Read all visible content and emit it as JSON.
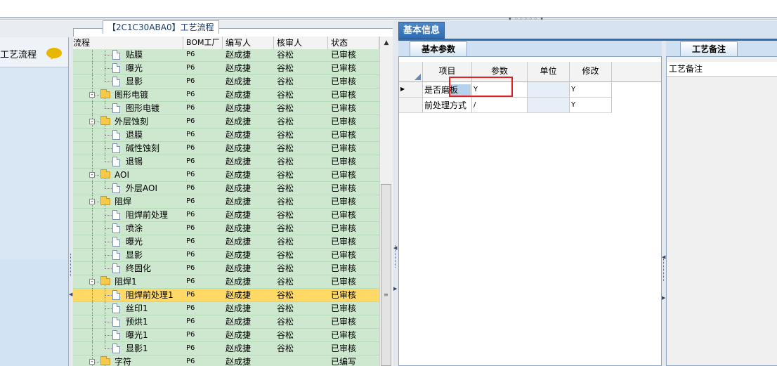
{
  "process_panel": {
    "title": "【2C1C30ABA0】工艺流程",
    "columns": [
      "流程",
      "BOM工厂",
      "编写人",
      "核审人",
      "状态"
    ],
    "rows": [
      {
        "name": "贴膜",
        "bom": "P6",
        "editor": "赵成捷",
        "reviewer": "谷松",
        "status": "已审核",
        "level": 1
      },
      {
        "name": "曝光",
        "bom": "P6",
        "editor": "赵成捷",
        "reviewer": "谷松",
        "status": "已审核",
        "level": 1
      },
      {
        "name": "显影",
        "bom": "P6",
        "editor": "赵成捷",
        "reviewer": "谷松",
        "status": "已审核",
        "level": 1
      },
      {
        "name": "图形电镀",
        "bom": "P6",
        "editor": "赵成捷",
        "reviewer": "谷松",
        "status": "已审核",
        "level": 0
      },
      {
        "name": "图形电镀",
        "bom": "P6",
        "editor": "赵成捷",
        "reviewer": "谷松",
        "status": "已审核",
        "level": 1
      },
      {
        "name": "外层蚀刻",
        "bom": "P6",
        "editor": "赵成捷",
        "reviewer": "谷松",
        "status": "已审核",
        "level": 0
      },
      {
        "name": "退膜",
        "bom": "P6",
        "editor": "赵成捷",
        "reviewer": "谷松",
        "status": "已审核",
        "level": 1
      },
      {
        "name": "碱性蚀刻",
        "bom": "P6",
        "editor": "赵成捷",
        "reviewer": "谷松",
        "status": "已审核",
        "level": 1
      },
      {
        "name": "退锡",
        "bom": "P6",
        "editor": "赵成捷",
        "reviewer": "谷松",
        "status": "已审核",
        "level": 1
      },
      {
        "name": "AOI",
        "bom": "P6",
        "editor": "赵成捷",
        "reviewer": "谷松",
        "status": "已审核",
        "level": 0
      },
      {
        "name": "外层AOI",
        "bom": "P6",
        "editor": "赵成捷",
        "reviewer": "谷松",
        "status": "已审核",
        "level": 1
      },
      {
        "name": "阻焊",
        "bom": "P6",
        "editor": "赵成捷",
        "reviewer": "谷松",
        "status": "已审核",
        "level": 0
      },
      {
        "name": "阻焊前处理",
        "bom": "P6",
        "editor": "赵成捷",
        "reviewer": "谷松",
        "status": "已审核",
        "level": 1
      },
      {
        "name": "喷涂",
        "bom": "P6",
        "editor": "赵成捷",
        "reviewer": "谷松",
        "status": "已审核",
        "level": 1
      },
      {
        "name": "曝光",
        "bom": "P6",
        "editor": "赵成捷",
        "reviewer": "谷松",
        "status": "已审核",
        "level": 1
      },
      {
        "name": "显影",
        "bom": "P6",
        "editor": "赵成捷",
        "reviewer": "谷松",
        "status": "已审核",
        "level": 1
      },
      {
        "name": "终固化",
        "bom": "P6",
        "editor": "赵成捷",
        "reviewer": "谷松",
        "status": "已审核",
        "level": 1
      },
      {
        "name": "阻焊1",
        "bom": "P6",
        "editor": "赵成捷",
        "reviewer": "谷松",
        "status": "已审核",
        "level": 0
      },
      {
        "name": "阻焊前处理1",
        "bom": "P6",
        "editor": "赵成捷",
        "reviewer": "谷松",
        "status": "已审核",
        "level": 1,
        "selected": true
      },
      {
        "name": "丝印1",
        "bom": "P6",
        "editor": "赵成捷",
        "reviewer": "谷松",
        "status": "已审核",
        "level": 1
      },
      {
        "name": "预烘1",
        "bom": "P6",
        "editor": "赵成捷",
        "reviewer": "谷松",
        "status": "已审核",
        "level": 1
      },
      {
        "name": "曝光1",
        "bom": "P6",
        "editor": "赵成捷",
        "reviewer": "谷松",
        "status": "已审核",
        "level": 1
      },
      {
        "name": "显影1",
        "bom": "P6",
        "editor": "赵成捷",
        "reviewer": "谷松",
        "status": "已审核",
        "level": 1
      },
      {
        "name": "字符",
        "bom": "P6",
        "editor": "赵成捷",
        "reviewer": "",
        "status": "已编写",
        "level": 0
      }
    ]
  },
  "left_nav": {
    "item_label": "工艺流程",
    "item_icon": "speech-bubble-icon"
  },
  "right_tabs": {
    "main_tab": "基本信息",
    "params_tab": "基本参数",
    "notes_tab": "工艺备注"
  },
  "params_table": {
    "columns": [
      "项目",
      "参数",
      "单位",
      "修改"
    ],
    "rows": [
      {
        "item": "是否磨板",
        "value": "Y",
        "unit": "",
        "modify": "Y",
        "current": true
      },
      {
        "item": "前处理方式",
        "value": "/",
        "unit": "",
        "modify": "Y",
        "current": false
      }
    ]
  },
  "notes_panel": {
    "header": "工艺备注"
  },
  "colors": {
    "row_bg": "#cde8cf",
    "selected_row": "#ffd966",
    "tab_blue": "#2f6db3",
    "highlight_box": "#e02020"
  }
}
